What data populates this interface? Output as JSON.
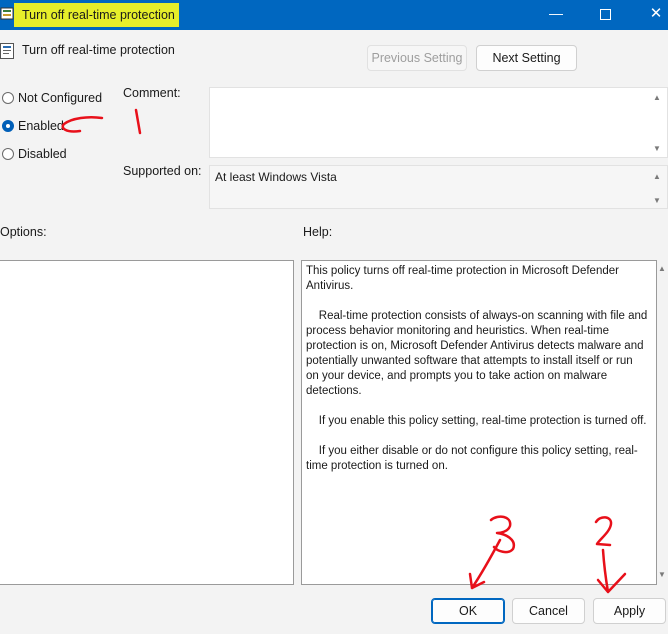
{
  "window": {
    "title": "Turn off real-time protection",
    "min_glyph": "—",
    "close_glyph": "✕"
  },
  "header": {
    "title": "Turn off real-time protection"
  },
  "nav": {
    "previous_label": "Previous Setting",
    "next_label": "Next Setting"
  },
  "state": {
    "options": [
      {
        "label": "Not Configured",
        "checked": false
      },
      {
        "label": "Enabled",
        "checked": true
      },
      {
        "label": "Disabled",
        "checked": false
      }
    ]
  },
  "comment": {
    "label": "Comment:",
    "value": ""
  },
  "supported": {
    "label": "Supported on:",
    "value": "At least Windows Vista"
  },
  "options_panel": {
    "label": "Options:"
  },
  "help": {
    "label": "Help:",
    "text": "This policy turns off real-time protection in Microsoft Defender Antivirus.\n\n    Real-time protection consists of always-on scanning with file and process behavior monitoring and heuristics. When real-time protection is on, Microsoft Defender Antivirus detects malware and potentially unwanted software that attempts to install itself or run on your device, and prompts you to take action on malware detections.\n\n    If you enable this policy setting, real-time protection is turned off.\n\n    If you either disable or do not configure this policy setting, real-time protection is turned on."
  },
  "footer": {
    "ok_label": "OK",
    "cancel_label": "Cancel",
    "apply_label": "Apply"
  },
  "annotations": {
    "step1": "1",
    "step2": "2",
    "step3": "3"
  },
  "colors": {
    "titlebar": "#0067c0",
    "title_highlight": "#e6ee2a",
    "annotation": "#e8101a",
    "accent": "#005fb8"
  }
}
